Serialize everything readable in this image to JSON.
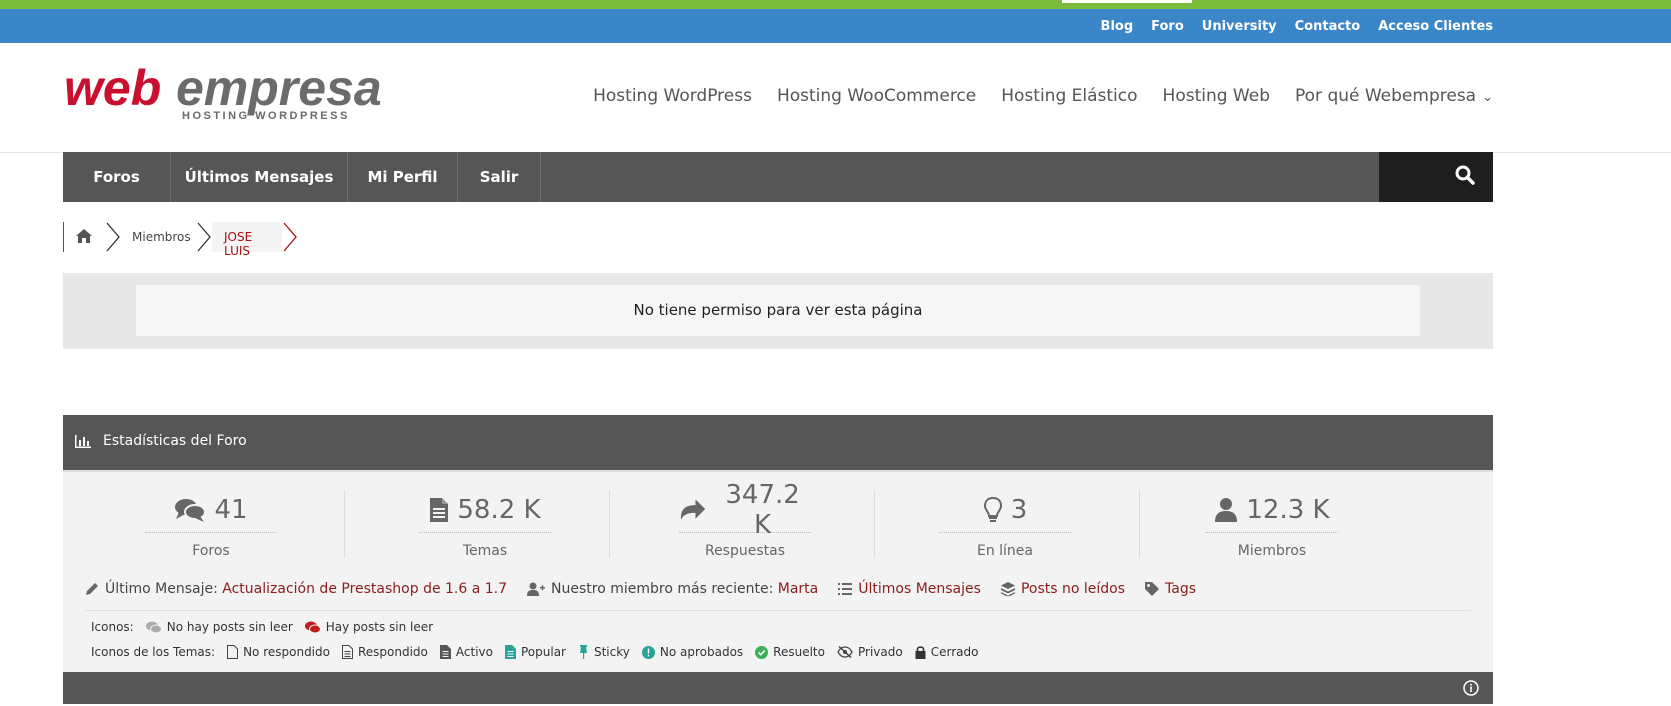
{
  "top_links": [
    "Blog",
    "Foro",
    "University",
    "Contacto",
    "Acceso Clientes"
  ],
  "logo": {
    "main_web": "web",
    "main_empresa": "empresa",
    "tagline": "HOSTING WORDPRESS",
    "brand_red": "#c8102e",
    "brand_gray": "#6b6b6b"
  },
  "main_nav": [
    "Hosting WordPress",
    "Hosting WooCommerce",
    "Hosting Elástico",
    "Hosting Web",
    "Por qué Webempresa"
  ],
  "forum_nav": [
    "Foros",
    "Últimos Mensajes",
    "Mi Perfil",
    "Salir"
  ],
  "breadcrumb": {
    "members": "Miembros",
    "current": "JOSE LUIS"
  },
  "notice": "No tiene permiso para ver esta página",
  "stats": {
    "title": "Estadísticas del Foro",
    "items": [
      {
        "icon": "comments-icon",
        "value": "41",
        "label": "Foros"
      },
      {
        "icon": "file-icon",
        "value": "58.2 K",
        "label": "Temas"
      },
      {
        "icon": "reply-icon",
        "value": "347.2 K",
        "label": "Respuestas"
      },
      {
        "icon": "lightbulb-icon",
        "value": "3",
        "label": "En línea"
      },
      {
        "icon": "user-icon",
        "value": "12.3 K",
        "label": "Miembros"
      }
    ]
  },
  "last_row": {
    "last_post_label": "Último Mensaje:",
    "last_post_link": "Actualización de Prestashop de 1.6 a 1.7",
    "newest_member_label": "Nuestro miembro más reciente:",
    "newest_member_link": "Marta",
    "latest_posts": "Últimos Mensajes",
    "unread": "Posts no leídos",
    "tags": "Tags"
  },
  "icons_legend": {
    "label": "Iconos:",
    "no_unread": "No hay posts sin leer",
    "has_unread": "Hay posts sin leer"
  },
  "topic_icons": {
    "label": "Iconos de los Temas:",
    "items": [
      "No respondido",
      "Respondido",
      "Activo",
      "Popular",
      "Sticky",
      "No aprobados",
      "Resuelto",
      "Privado",
      "Cerrado"
    ]
  },
  "colors": {
    "green": "#7dbb3c",
    "blue": "#3b86c8",
    "dark": "#565656",
    "red_link": "#8b1c1c",
    "teal": "#2aa39a"
  }
}
